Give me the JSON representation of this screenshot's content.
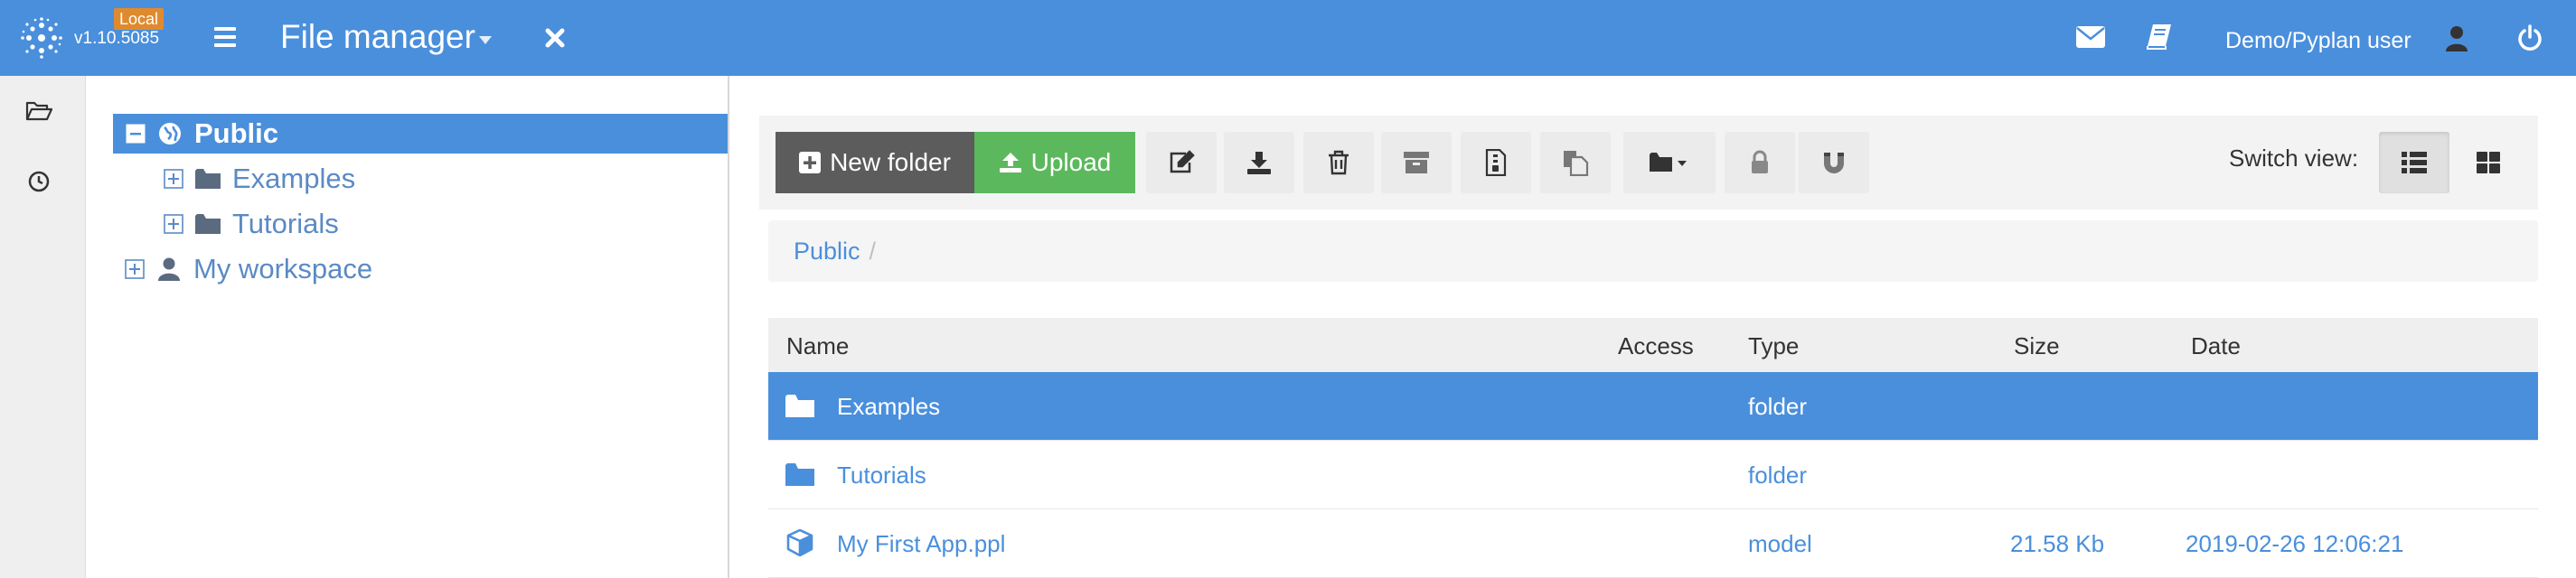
{
  "header": {
    "env_badge": "Local",
    "version": "v1.10.5085",
    "title": "File manager",
    "user": "Demo/Pyplan user",
    "colors": {
      "bar": "#4a8fdc",
      "badge": "#e08a2e"
    }
  },
  "rail": {
    "items": [
      {
        "icon": "folder-open-icon"
      },
      {
        "icon": "clock-icon"
      }
    ]
  },
  "tree": {
    "items": [
      {
        "label": "Public",
        "icon": "globe-icon",
        "expander": "minus",
        "selected": true
      },
      {
        "label": "Examples",
        "icon": "folder-icon",
        "expander": "plus",
        "selected": false
      },
      {
        "label": "Tutorials",
        "icon": "folder-icon",
        "expander": "plus",
        "selected": false
      },
      {
        "label": "My workspace",
        "icon": "user-icon",
        "expander": "plus",
        "selected": false
      }
    ]
  },
  "toolbar": {
    "new_folder": "New folder",
    "upload": "Upload",
    "tools": [
      "edit-icon",
      "download-icon",
      "trash-icon",
      "archive-icon",
      "unzip-icon",
      "copy-icon",
      "folder-dropdown-icon",
      "lock-icon",
      "magnet-icon"
    ],
    "switch_view_label": "Switch view:",
    "views": [
      "list-view-icon",
      "grid-view-icon"
    ],
    "active_view": "list",
    "colors": {
      "new_folder": "#5c5c5c",
      "upload": "#5cb85c"
    }
  },
  "breadcrumb": {
    "items": [
      "Public"
    ],
    "separator": "/"
  },
  "table": {
    "columns": [
      "Name",
      "Access",
      "Type",
      "Size",
      "Date"
    ],
    "rows": [
      {
        "name": "Examples",
        "access": "",
        "type": "folder",
        "size": "",
        "date": "",
        "icon": "folder-icon",
        "selected": true
      },
      {
        "name": "Tutorials",
        "access": "",
        "type": "folder",
        "size": "",
        "date": "",
        "icon": "folder-icon",
        "selected": false
      },
      {
        "name": "My First App.ppl",
        "access": "",
        "type": "model",
        "size": "21.58 Kb",
        "date": "2019-02-26 12:06:21",
        "icon": "cube-icon",
        "selected": false
      }
    ]
  }
}
